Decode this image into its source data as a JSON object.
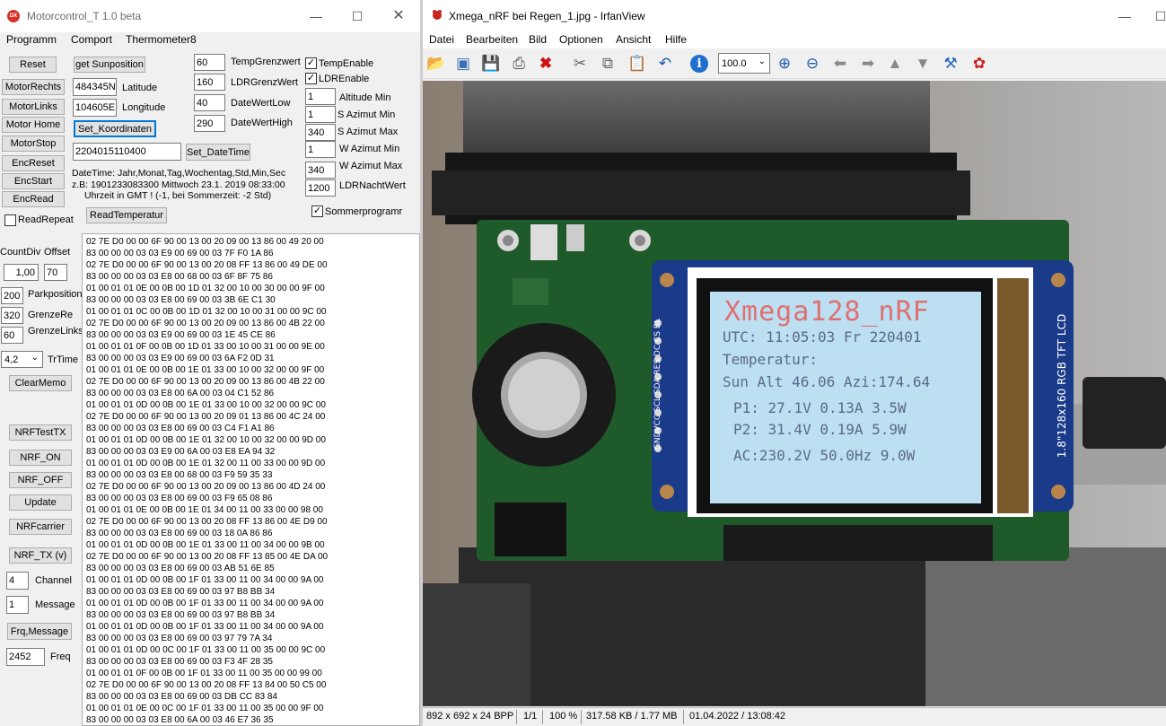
{
  "left_window": {
    "title": "Motorcontrol_T 1.0 beta",
    "icon": "app-icon",
    "menu": [
      "Programm",
      "Comport",
      "Thermometer8"
    ],
    "buttons": {
      "reset": "Reset",
      "motor_rechts": "MotorRechts",
      "motor_links": "MotorLinks",
      "motor_home": "Motor Home",
      "motor_stop": "MotorStop",
      "enc_reset": "EncReset",
      "enc_start": "EncStart",
      "enc_read": "EncRead",
      "get_sunposition": "get Sunposition",
      "set_koordinaten": "Set_Koordinaten",
      "set_datetime": "Set_DateTime",
      "read_temperatur": "ReadTemperatur",
      "clear_memo": "ClearMemo",
      "nrf_test_tx": "NRFTestTX",
      "nrf_on": "NRF_ON",
      "nrf_off": "NRF_OFF",
      "update": "Update",
      "nrf_carrier": "NRFcarrier",
      "nrf_tx_v": "NRF_TX (v)",
      "frq_message": "Frq,Message"
    },
    "fields": {
      "latitude_value": "484345N",
      "latitude_label": "Latitude",
      "longitude_value": "104605E",
      "longitude_label": "Longitude",
      "datetime_value": "2204015110400",
      "temp_grenz_value": "60",
      "temp_grenz_label": "TempGrenzwert",
      "ldr_grenz_value": "160",
      "ldr_grenz_label": "LDRGrenzWert",
      "date_low_value": "40",
      "date_low_label": "DateWertLow",
      "date_high_value": "290",
      "date_high_label": "DateWertHigh",
      "altitude_min_value": "1",
      "altitude_min_label": "Altitude Min",
      "s_azimut_min_value": "1",
      "s_azimut_min_label": "S Azimut Min",
      "s_azimut_max_value": "340",
      "s_azimut_max_label": "S Azimut Max",
      "w_azimut_min_value": "1",
      "w_azimut_min_label": "W Azimut Min",
      "w_azimut_max_value": "340",
      "w_azimut_max_label": "W Azimut Max",
      "ldr_nacht_value": "1200",
      "ldr_nacht_label": "LDRNachtWert",
      "count_div_label": "CountDiv",
      "count_div_value": "1,00",
      "offset_label": "Offset",
      "offset_value": "70",
      "parkposition_value": "200",
      "parkposition_label": "Parkposition",
      "grenze_re_value": "320",
      "grenze_re_label": "GrenzeRe",
      "grenze_links_value": "60",
      "grenze_links_label": "GrenzeLinks",
      "trtime_value": "4,2",
      "trtime_label": "TrTime",
      "channel_value": "4",
      "channel_label": "Channel",
      "message_value": "1",
      "message_label": "Message",
      "freq_value": "2452",
      "freq_label": "Freq"
    },
    "checkboxes": {
      "temp_enable": {
        "label": "TempEnable",
        "checked": true
      },
      "ldr_enable": {
        "label": "LDREnable",
        "checked": true
      },
      "sommerprogramm": {
        "label": "Sommerprogramr",
        "checked": true
      },
      "read_repeat": {
        "label": "ReadRepeat",
        "checked": false
      }
    },
    "info_lines": [
      "DateTime:  Jahr,Monat,Tag,Wochentag,Std,Min,Sec",
      "z.B: 1901233083300  Mittwoch 23.1. 2019 08:33:00",
      "Uhrzeit in GMT ! (-1, bei Sommerzeit: -2 Std)"
    ],
    "memo_lines": [
      "02 7E D0 00 00 6F 90 00 13 00 20 09 00 13 86 00 49 20 00",
      "83 00 00 00 03 03 E9 00 69 00 03 7F F0 1A 86",
      "02 7E D0 00 00 6F 90 00 13 00 20 08 FF 13 86 00 49 DE 00",
      "83 00 00 00 03 03 E8 00 68 00 03 6F 8F 75 86",
      "01 00 01 01 0E 00 0B 00 1D 01 32 00 10 00 30 00 00 9F 00",
      "83 00 00 00 03 03 E8 00 69 00 03 3B 6E C1 30",
      "01 00 01 01 0C 00 0B 00 1D 01 32 00 10 00 31 00 00 9C 00",
      "02 7E D0 00 00 6F 90 00 13 00 20 09 00 13 86 00 4B 22 00",
      "83 00 00 00 03 03 E9 00 69 00 03 1E 45 CE 86",
      "01 00 01 01 0F 00 0B 00 1D 01 33 00 10 00 31 00 00 9E 00",
      "83 00 00 00 03 03 E9 00 69 00 03 6A F2 0D 31",
      "01 00 01 01 0E 00 0B 00 1E 01 33 00 10 00 32 00 00 9F 00",
      "02 7E D0 00 00 6F 90 00 13 00 20 09 00 13 86 00 4B 22 00",
      "83 00 00 00 03 03 E8 00 6A 00 03 04 C1 52 86",
      "01 00 01 01 0D 00 0B 00 1E 01 33 00 10 00 32 00 00 9C 00",
      "02 7E D0 00 00 6F 90 00 13 00 20 09 01 13 86 00 4C 24 00",
      "83 00 00 00 03 03 E8 00 69 00 03 C4 F1 A1 86",
      "01 00 01 01 0D 00 0B 00 1E 01 32 00 10 00 32 00 00 9D 00",
      "83 00 00 00 03 03 E9 00 6A 00 03 E8 EA 94 32",
      "01 00 01 01 0D 00 0B 00 1E 01 32 00 11 00 33 00 00 9D 00",
      "83 00 00 00 03 03 E8 00 68 00 03 F9 59 35 33",
      "02 7E D0 00 00 6F 90 00 13 00 20 09 00 13 86 00 4D 24 00",
      "83 00 00 00 03 03 E8 00 69 00 03 F9 65 08 86",
      "01 00 01 01 0E 00 0B 00 1E 01 34 00 11 00 33 00 00 98 00",
      "02 7E D0 00 00 6F 90 00 13 00 20 08 FF 13 86 00 4E D9 00",
      "83 00 00 00 03 03 E8 00 69 00 03 18 0A 86 86",
      "01 00 01 01 0D 00 0B 00 1E 01 33 00 11 00 34 00 00 9B 00",
      "02 7E D0 00 00 6F 90 00 13 00 20 08 FF 13 85 00 4E DA 00",
      "83 00 00 00 03 03 E8 00 69 00 03 AB 51 6E 85",
      "01 00 01 01 0D 00 0B 00 1F 01 33 00 11 00 34 00 00 9A 00",
      "83 00 00 00 03 03 E8 00 69 00 03 97 B8 BB 34",
      "01 00 01 01 0D 00 0B 00 1F 01 33 00 11 00 34 00 00 9A 00",
      "83 00 00 00 03 03 E8 00 69 00 03 97 B8 BB 34",
      "01 00 01 01 0D 00 0B 00 1F 01 33 00 11 00 34 00 00 9A 00",
      "83 00 00 00 03 03 E8 00 69 00 03 97 79 7A 34",
      "01 00 01 01 0D 00 0C 00 1F 01 33 00 11 00 35 00 00 9C 00",
      "83 00 00 00 03 03 E8 00 69 00 03 F3 4F 28 35",
      "01 00 01 01 0F 00 0B 00 1F 01 33 00 11 00 35 00 00 99 00",
      "02 7E D0 00 00 6F 90 00 13 00 20 08 FF 13 84 00 50 C5 00",
      "83 00 00 00 03 03 E8 00 69 00 03 DB CC 83 84",
      "01 00 01 01 0E 00 0C 00 1F 01 33 00 11 00 35 00 00 9F 00",
      "83 00 00 00 03 03 E8 00 6A 00 03 46 E7 36 35"
    ]
  },
  "right_window": {
    "title": "Xmega_nRF bei Regen_1.jpg - IrfanView",
    "menu": [
      "Datei",
      "Bearbeiten",
      "Bild",
      "Optionen",
      "Ansicht",
      "Hilfe"
    ],
    "zoom_value": "100.0",
    "toolbar_icons": [
      "open-folder-icon",
      "thumbnails-icon",
      "save-icon",
      "print-icon",
      "delete-icon",
      "cut-icon",
      "copy-icon",
      "paste-icon",
      "undo-icon",
      "info-icon",
      "zoom-in-icon",
      "zoom-out-icon",
      "previous-icon",
      "next-icon",
      "page-previous-icon",
      "page-next-icon",
      "settings-icon",
      "irfanview-icon"
    ],
    "status": [
      "892 x 692 x 24 BPP",
      "1/1",
      "100 %",
      "317.58 KB / 1.77 MB",
      "01.04.2022 / 13:08:42"
    ],
    "lcd_lines": [
      "Xmega128_nRF",
      "UTC: 11:05:03 Fr 220401",
      "Temperatur:",
      "Sun Alt 46.06 Azi:174.64",
      "P1: 27.1V 0.13A 3.5W",
      "P2: 31.4V 0.19A 5.9W",
      "AC:230.2V 50.0Hz 9.0W"
    ],
    "lcd_side_label": "1.8\"128x160 RGB TFT LCD",
    "lcd_pins_label": "GNDVCC SCL SDA RES DC CS BL"
  },
  "colors": {
    "lcd_screen": "#bcdff2",
    "lcd_text": "#5a6a8a",
    "lcd_board": "#1a3a8a",
    "pcb": "#1f5a2a",
    "focus_border": "#0078d7"
  }
}
